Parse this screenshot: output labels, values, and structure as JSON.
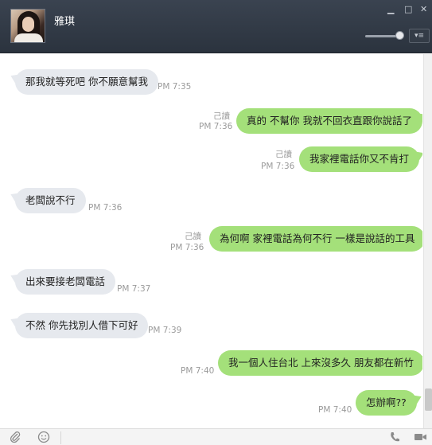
{
  "header": {
    "contact_name": "雅琪",
    "minimize_glyph": "▁",
    "maximize_glyph": "□",
    "close_glyph": "✕",
    "menu_glyph": "▾≡"
  },
  "messages": [
    {
      "dir": "in",
      "text": "那我就等死吧 你不願意幫我",
      "time": "PM 7:35",
      "read": ""
    },
    {
      "dir": "out",
      "text": "真的 不幫你 我就不回衣直跟你說話了",
      "time": "PM 7:36",
      "read": "己讀"
    },
    {
      "dir": "out",
      "text": "我家裡電話你又不肯打",
      "time": "PM 7:36",
      "read": "己讀"
    },
    {
      "dir": "in",
      "text": "老闆說不行",
      "time": "PM 7:36",
      "read": ""
    },
    {
      "dir": "out",
      "text": "為何啊 家裡電話為何不行 一樣是說話的工具",
      "time": "PM 7:36",
      "read": "己讀"
    },
    {
      "dir": "in",
      "text": "出來要接老闆電話",
      "time": "PM 7:37",
      "read": ""
    },
    {
      "dir": "in",
      "text": "不然 你先找別人借下可好",
      "time": "PM 7:39",
      "read": ""
    },
    {
      "dir": "out",
      "text": "我一個人住台北 上來沒多久 朋友都在新竹",
      "time": "PM 7:40",
      "read": ""
    },
    {
      "dir": "out",
      "text": "怎辦啊??",
      "time": "PM 7:40",
      "read": ""
    }
  ],
  "footer": {
    "attach_icon": "paperclip-icon",
    "emoji_icon": "smiley-icon",
    "call_icon": "phone-icon",
    "video_icon": "video-icon"
  },
  "colors": {
    "header_bg": "#2f3742",
    "incoming_bubble": "#e6e9ee",
    "outgoing_bubble": "#a4e07a"
  }
}
